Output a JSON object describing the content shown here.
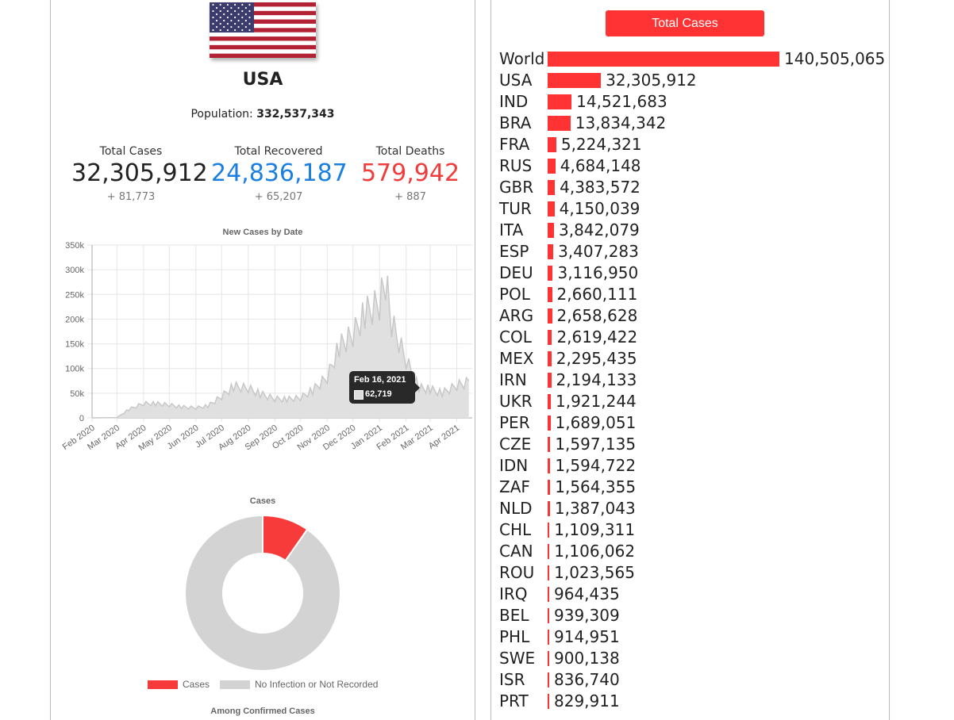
{
  "country": {
    "name": "USA",
    "population_label": "Population:",
    "population": "332,537,343"
  },
  "stats": [
    {
      "label": "Total Cases",
      "value": "32,305,912",
      "delta": "+ 81,773",
      "color": "#222222"
    },
    {
      "label": "Total Recovered",
      "value": "24,836,187",
      "delta": "+ 65,207",
      "color": "#1a7fe0"
    },
    {
      "label": "Total Deaths",
      "value": "579,942",
      "delta": "+ 887",
      "color": "#f23c3c"
    }
  ],
  "chart_data": [
    {
      "type": "area",
      "title": "New Cases by Date",
      "y_ticks": [
        "350k",
        "300k",
        "250k",
        "200k",
        "150k",
        "100k",
        "50k",
        "0"
      ],
      "ylim": [
        0,
        350000
      ],
      "x_ticks": [
        "Feb 2020",
        "Mar 2020",
        "Apr 2020",
        "May 2020",
        "Jun 2020",
        "Jul 2020",
        "Aug 2020",
        "Sep 2020",
        "Oct 2020",
        "Nov 2020",
        "Dec 2020",
        "Jan 2021",
        "Feb 2021",
        "Mar 2021",
        "Apr 2021"
      ],
      "grid": true,
      "series": [
        {
          "x": [
            "2020-02-01",
            "2020-03-01",
            "2020-03-15",
            "2020-04-01",
            "2020-04-15",
            "2020-05-01",
            "2020-05-15",
            "2020-06-01",
            "2020-06-15",
            "2020-07-01",
            "2020-07-15",
            "2020-08-01",
            "2020-08-15",
            "2020-09-01",
            "2020-09-15",
            "2020-10-01",
            "2020-10-15",
            "2020-11-01",
            "2020-11-15",
            "2020-12-01",
            "2020-12-15",
            "2021-01-01",
            "2021-01-08",
            "2021-01-15",
            "2021-02-01",
            "2021-02-16",
            "2021-03-01",
            "2021-03-15",
            "2021-04-01",
            "2021-04-15"
          ],
          "values": [
            0,
            500,
            18000,
            30000,
            30000,
            27000,
            23000,
            21000,
            25000,
            45000,
            66000,
            62000,
            50000,
            40000,
            39000,
            42000,
            58000,
            85000,
            150000,
            175000,
            220000,
            240000,
            290000,
            200000,
            120000,
            62719,
            60000,
            52000,
            68000,
            75000
          ]
        }
      ],
      "tooltip": {
        "date": "Feb 16, 2021",
        "value": "62,719"
      },
      "fill_color": "#e0e0e0",
      "line_color": "#c8c8c8"
    },
    {
      "type": "pie",
      "title": "Cases",
      "labels": [
        "Cases",
        "No Infection or Not Recorded"
      ],
      "values": [
        32305912,
        300231431
      ],
      "colors": [
        "#f73b3b",
        "#d3d3d3"
      ],
      "legend_position": "bottom"
    },
    {
      "type": "bar",
      "orientation": "horizontal",
      "title": "Total Cases",
      "bar_color": "#f33",
      "categories": [
        "World",
        "USA",
        "IND",
        "BRA",
        "FRA",
        "RUS",
        "GBR",
        "TUR",
        "ITA",
        "ESP",
        "DEU",
        "POL",
        "ARG",
        "COL",
        "MEX",
        "IRN",
        "UKR",
        "PER",
        "CZE",
        "IDN",
        "ZAF",
        "NLD",
        "CHL",
        "CAN",
        "ROU",
        "IRQ",
        "BEL",
        "PHL",
        "SWE",
        "ISR",
        "PRT"
      ],
      "values": [
        140505065,
        32305912,
        14521683,
        13834342,
        5224321,
        4684148,
        4383572,
        4150039,
        3842079,
        3407283,
        3116950,
        2660111,
        2658628,
        2619422,
        2295435,
        2194133,
        1921244,
        1689051,
        1597135,
        1594722,
        1564355,
        1387043,
        1109311,
        1106062,
        1023565,
        964435,
        939309,
        914951,
        900138,
        836740,
        829911
      ],
      "value_labels": [
        "140,505,065",
        "32,305,912",
        "14,521,683",
        "13,834,342",
        "5,224,321",
        "4,684,148",
        "4,383,572",
        "4,150,039",
        "3,842,079",
        "3,407,283",
        "3,116,950",
        "2,660,111",
        "2,658,628",
        "2,619,422",
        "2,295,435",
        "2,194,133",
        "1,921,244",
        "1,689,051",
        "1,597,135",
        "1,594,722",
        "1,564,355",
        "1,387,043",
        "1,109,311",
        "1,106,062",
        "1,023,565",
        "964,435",
        "939,309",
        "914,951",
        "900,138",
        "836,740",
        "829,911"
      ]
    }
  ],
  "bottom_caption": "Among Confirmed Cases",
  "right_panel": {
    "button_label": "Total Cases"
  },
  "colors": {
    "accent": "#ff3333",
    "recovered": "#1a7fe0",
    "deaths": "#f23c3c"
  }
}
